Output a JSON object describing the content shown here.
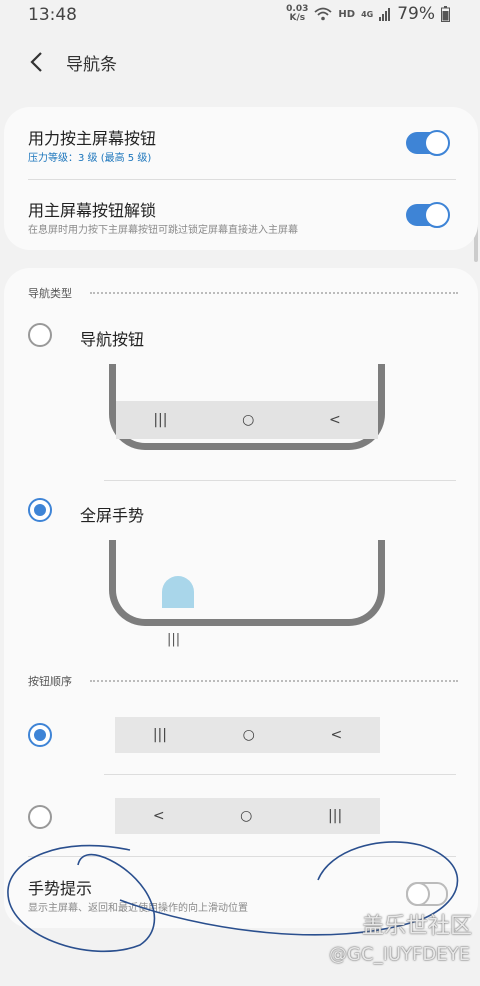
{
  "status": {
    "time": "13:48",
    "speed_top": "0.03",
    "speed_unit": "K/s",
    "hd": "HD",
    "net": "4G",
    "battery": "79%"
  },
  "header": {
    "title": "导航条"
  },
  "pressure": {
    "title": "用力按主屏幕按钮",
    "subtitle": "压力等级：3 级 (最高 5 级)",
    "enabled": true
  },
  "unlock": {
    "title": "用主屏幕按钮解锁",
    "subtitle": "在息屏时用力按下主屏幕按钮可跳过锁定屏幕直接进入主屏幕",
    "enabled": true
  },
  "nav_type": {
    "label": "导航类型",
    "options": [
      {
        "label": "导航按钮",
        "selected": false,
        "keys": [
          "|||",
          "○",
          "<"
        ]
      },
      {
        "label": "全屏手势",
        "selected": true,
        "hint": "|||"
      }
    ]
  },
  "button_order": {
    "label": "按钮顺序",
    "options": [
      {
        "selected": true,
        "keys": [
          "|||",
          "○",
          "<"
        ]
      },
      {
        "selected": false,
        "keys": [
          "<",
          "○",
          "|||"
        ]
      }
    ]
  },
  "gesture_hint": {
    "title": "手势提示",
    "subtitle": "显示主屏幕、返回和最近使用操作的向上滑动位置",
    "enabled": false
  },
  "watermark": {
    "brand": "盖乐世社区",
    "user": "@GC_IUYFDEYE"
  },
  "colors": {
    "accent": "#3e84d6",
    "pill": "#a9d6ea"
  }
}
